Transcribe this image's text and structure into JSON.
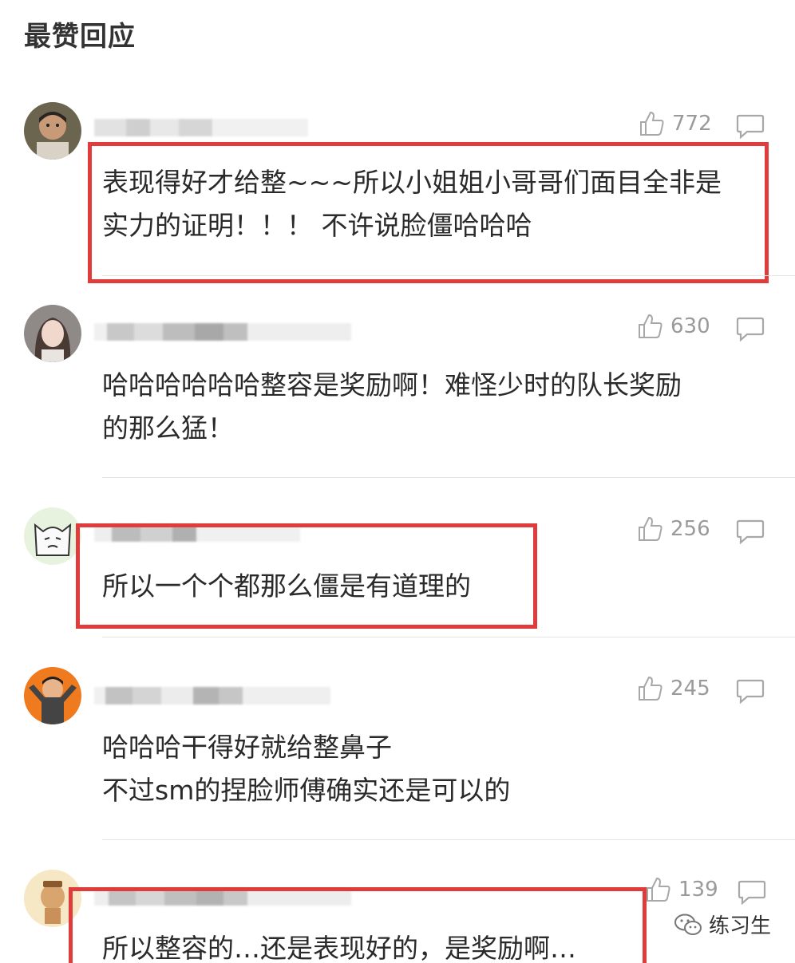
{
  "section_title": "最赞回应",
  "comments": [
    {
      "likes": "772",
      "text": "表现得好才给整~~~所以小姐姐小哥哥们面目全非是\n实力的证明！！！ 不许说脸僵哈哈哈"
    },
    {
      "likes": "630",
      "text": "哈哈哈哈哈哈整容是奖励啊！难怪少时的队长奖励\n的那么猛！"
    },
    {
      "likes": "256",
      "text": "所以一个个都那么僵是有道理的"
    },
    {
      "likes": "245",
      "text": "哈哈哈干得好就给整鼻子\n不过sm的捏脸师傅确实还是可以的"
    },
    {
      "likes": "139",
      "text": "所以整容的…还是表现好的，是奖励啊…"
    }
  ],
  "watermark": {
    "label": "练习生"
  },
  "colors": {
    "highlight_box": "#e03c3c",
    "meta_text": "#9a9a9a"
  }
}
